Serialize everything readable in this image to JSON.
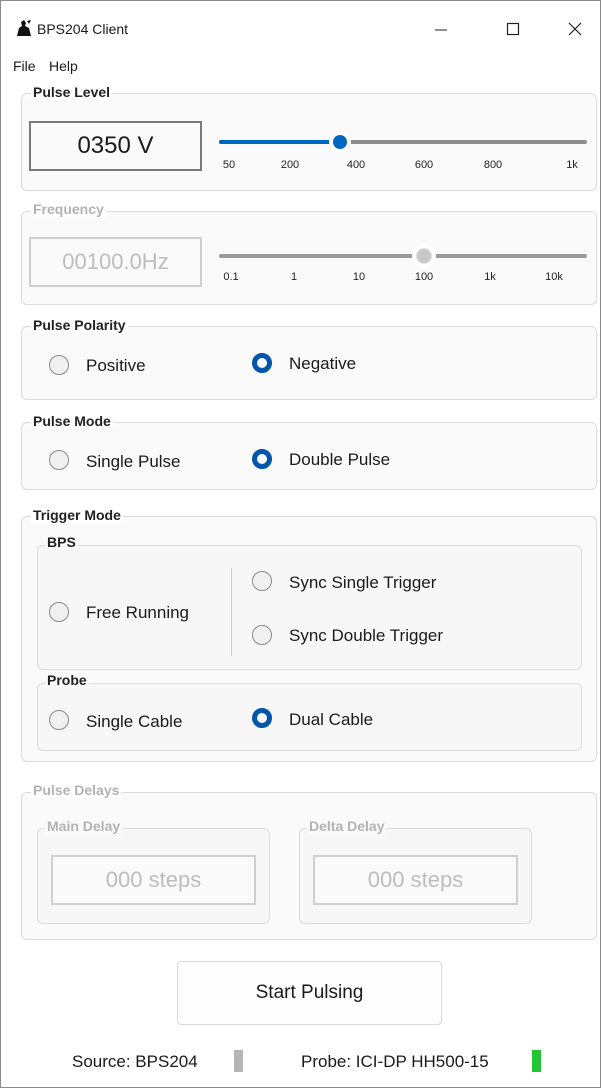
{
  "window": {
    "title": "BPS204 Client"
  },
  "menu": {
    "file": "File",
    "help": "Help"
  },
  "pulse_level": {
    "legend": "Pulse Level",
    "value_display": "0350 V",
    "ticks": [
      "50",
      "200",
      "400",
      "600",
      "800",
      "1k"
    ]
  },
  "frequency": {
    "legend": "Frequency",
    "value_display": "00100.0Hz",
    "ticks": [
      "0.1",
      "1",
      "10",
      "100",
      "1k",
      "10k"
    ]
  },
  "pulse_polarity": {
    "legend": "Pulse Polarity",
    "positive": "Positive",
    "negative": "Negative",
    "selected": "Negative"
  },
  "pulse_mode": {
    "legend": "Pulse Mode",
    "single": "Single Pulse",
    "double": "Double Pulse",
    "selected": "Double Pulse"
  },
  "trigger_mode": {
    "legend": "Trigger Mode",
    "bps": {
      "legend": "BPS",
      "free_running": "Free Running",
      "sync_single": "Sync Single Trigger",
      "sync_double": "Sync Double Trigger"
    },
    "probe": {
      "legend": "Probe",
      "single_cable": "Single Cable",
      "dual_cable": "Dual Cable",
      "selected": "Dual Cable"
    }
  },
  "pulse_delays": {
    "legend": "Pulse Delays",
    "main_delay": {
      "legend": "Main Delay",
      "value": "000 steps"
    },
    "delta_delay": {
      "legend": "Delta Delay",
      "value": "000 steps"
    }
  },
  "start_button": "Start Pulsing",
  "statusbar": {
    "source": "Source: BPS204",
    "source_color": "#b5b5b5",
    "probe": "Probe: ICI-DP HH500-15",
    "probe_color": "#22c532"
  }
}
